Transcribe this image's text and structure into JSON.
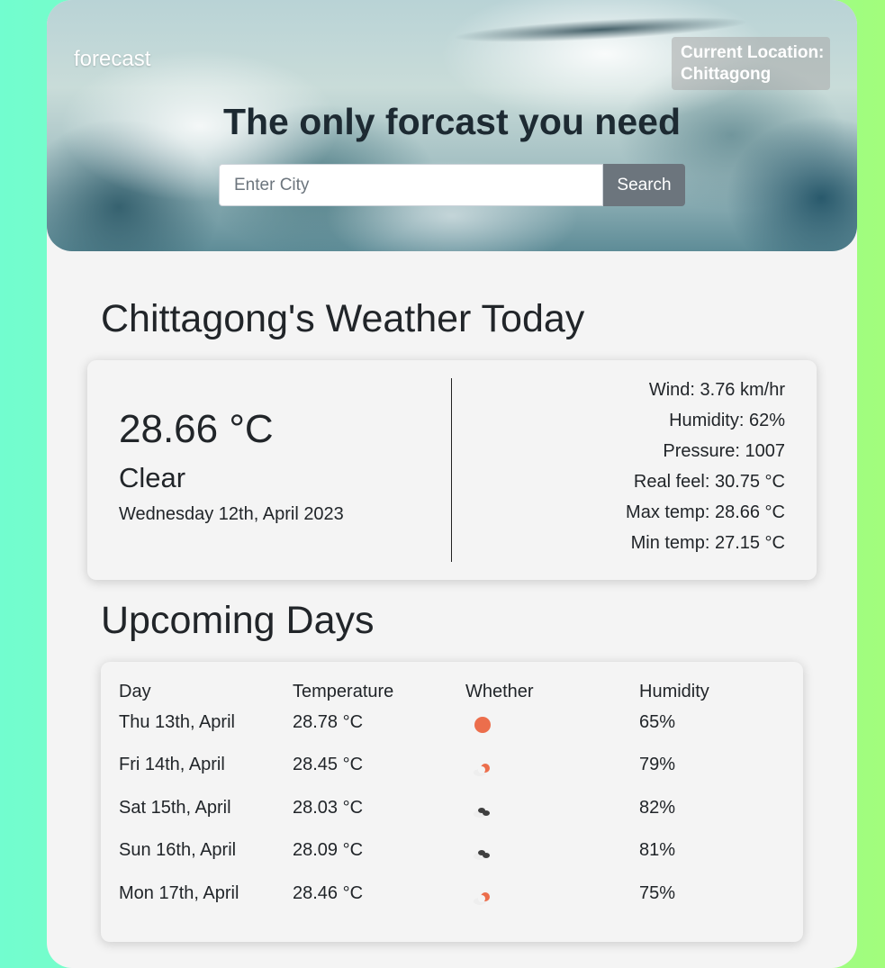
{
  "header": {
    "brand": "forecast",
    "location_label": "Current Location:",
    "location_city": "Chittagong",
    "headline": "The only forcast you need",
    "search_placeholder": "Enter City",
    "search_button": "Search"
  },
  "today": {
    "title": "Chittagong's Weather Today",
    "temperature": "28.66 °C",
    "condition": "Clear",
    "date": "Wednesday 12th, April 2023",
    "stats": [
      "Wind: 3.76 km/hr",
      "Humidity: 62%",
      "Pressure: 1007",
      "Real feel: 30.75 °C",
      "Max temp: 28.66 °C",
      "Min temp: 27.15 °C"
    ]
  },
  "upcoming": {
    "title": "Upcoming Days",
    "headers": [
      "Day",
      "Temperature",
      "Whether",
      "Humidity"
    ],
    "rows": [
      {
        "day": "Thu 13th, April",
        "temp": "28.78 °C",
        "icon": "clear-sun-icon",
        "humidity": "65%"
      },
      {
        "day": "Fri 14th, April",
        "temp": "28.45 °C",
        "icon": "partly-cloudy-icon",
        "humidity": "79%"
      },
      {
        "day": "Sat 15th, April",
        "temp": "28.03 °C",
        "icon": "broken-clouds-icon",
        "humidity": "82%"
      },
      {
        "day": "Sun 16th, April",
        "temp": "28.09 °C",
        "icon": "broken-clouds-icon",
        "humidity": "81%"
      },
      {
        "day": "Mon 17th, April",
        "temp": "28.46 °C",
        "icon": "partly-cloudy-icon",
        "humidity": "75%"
      }
    ]
  },
  "colors": {
    "accent_sun": "#ec6e4c",
    "cloud_dark": "#3f3f3f",
    "button_gray": "#6c757d"
  }
}
